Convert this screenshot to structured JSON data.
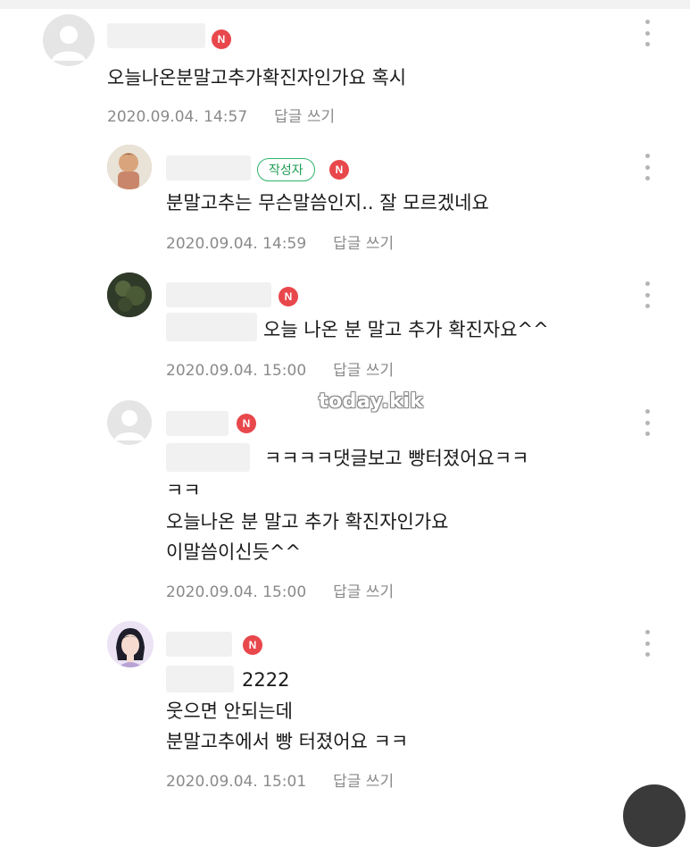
{
  "watermark": "today.kik",
  "author_badge_label": "작성자",
  "badge_letter": "N",
  "reply_label": "답글 쓰기",
  "comments": [
    {
      "text_lines": [
        "오늘나온분말고추가확진자인가요 혹시"
      ],
      "timestamp": "2020.09.04. 14:57"
    },
    {
      "text_lines": [
        "분말고추는 무슨말씀인지.. 잘 모르겠네요"
      ],
      "timestamp": "2020.09.04. 14:59"
    },
    {
      "text_lines": [
        "오늘 나온 분 말고 추가 확진자요^^"
      ],
      "timestamp": "2020.09.04. 15:00"
    },
    {
      "text_lines": [
        "ㅋㅋㅋㅋ댓글보고 빵터졌어요ㅋㅋ",
        "ㅋㅋ",
        "오늘나온 분 말고 추가 확진자인가요",
        "이말씀이신듯^^"
      ],
      "timestamp": "2020.09.04. 15:00"
    },
    {
      "text_lines": [
        "2222",
        "웃으면 안되는데",
        "분말고추에서 빵 터졌어요 ㅋㅋ"
      ],
      "timestamp": "2020.09.04. 15:01"
    }
  ]
}
